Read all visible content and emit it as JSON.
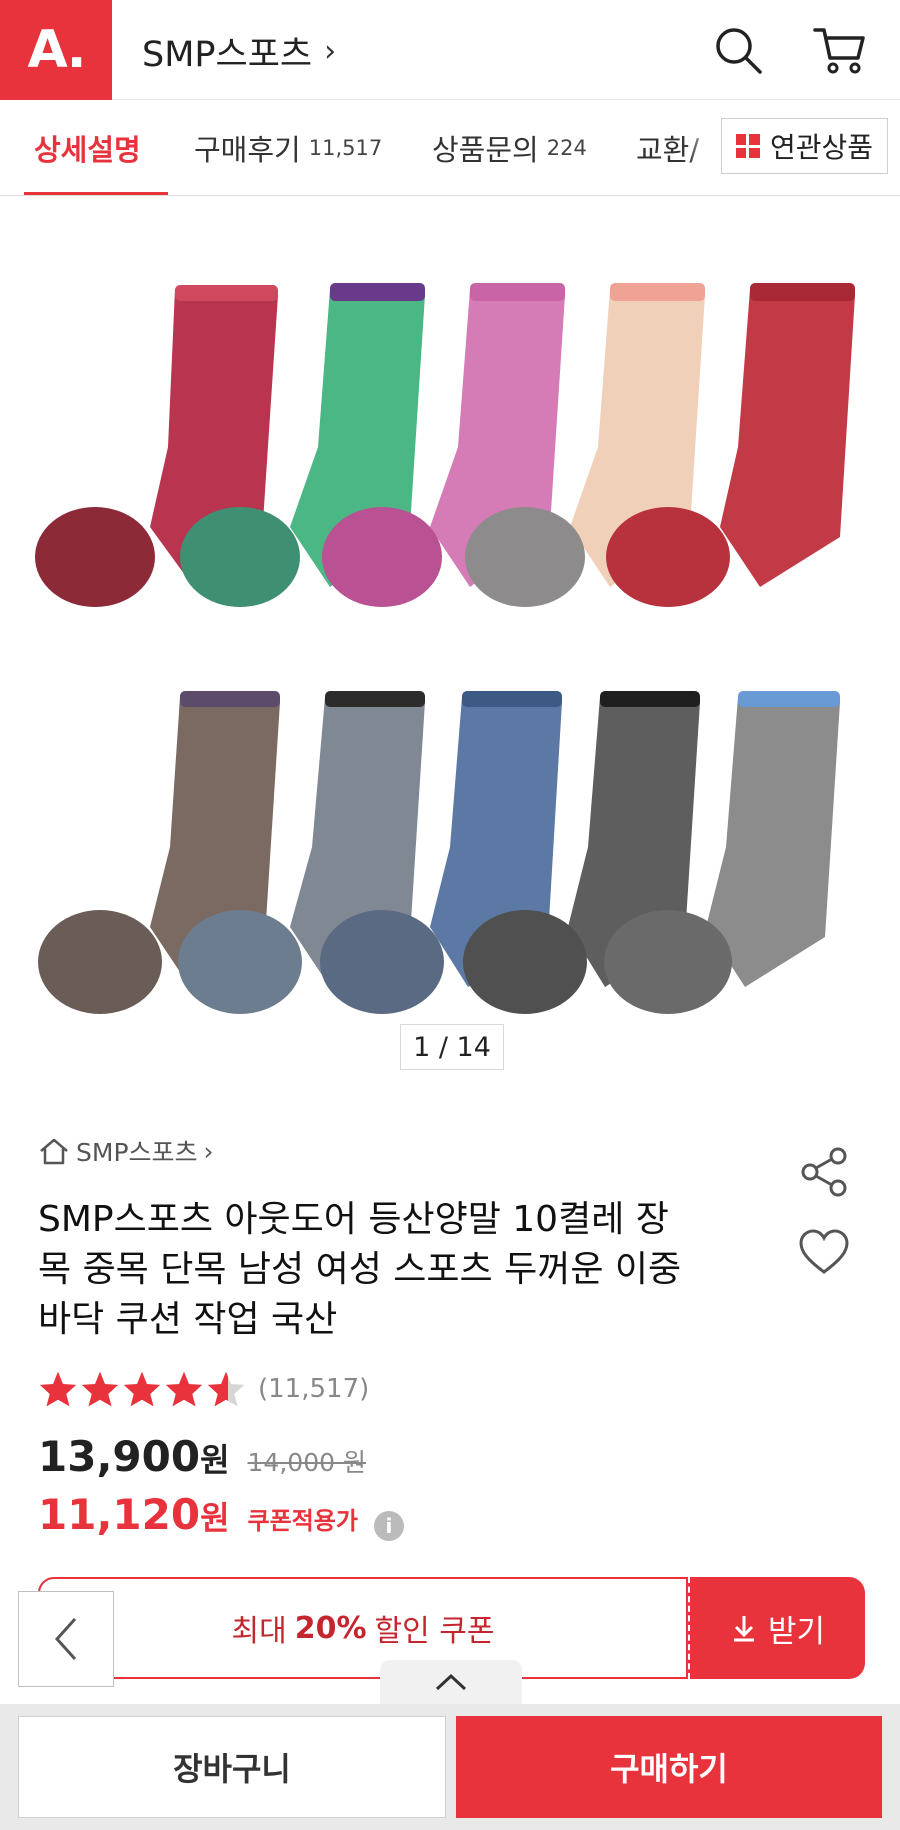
{
  "header": {
    "logo_text": "A.",
    "store_name": "SMP스포츠",
    "store_chevron": "›"
  },
  "tabs": [
    {
      "label": "상세설명",
      "count": ""
    },
    {
      "label": "구매후기",
      "count": "11,517"
    },
    {
      "label": "상품문의",
      "count": "224"
    },
    {
      "label": "교환/",
      "count": ""
    }
  ],
  "related_button": "연관상품",
  "gallery": {
    "indicator": "1 / 14"
  },
  "product": {
    "brand": "SMP스포츠",
    "brand_chevron": "›",
    "title": "SMP스포츠 아웃도어 등산양말 10켤레 장목 중목 단목 남성 여성 스포츠 두꺼운 이중바닥 쿠션 작업 국산",
    "rating": 4.5,
    "review_count": "(11,517)",
    "price": "13,900",
    "price_unit": "원",
    "original_price": "14,000 원",
    "coupon_price": "11,120",
    "coupon_unit": "원",
    "coupon_tag": "쿠폰적용가",
    "info_icon": "i"
  },
  "coupon": {
    "prefix": "최대",
    "percent": "20%",
    "suffix": "할인 쿠폰",
    "get_label": "받기"
  },
  "bottom": {
    "cart_label": "장바구니",
    "buy_label": "구매하기"
  },
  "colors": {
    "brand_red": "#e8333d"
  }
}
